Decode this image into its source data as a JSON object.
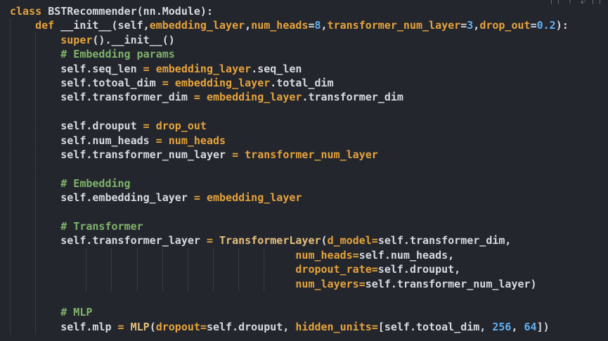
{
  "toolbar": {
    "icons": [
      "copy-icon",
      "split-icon",
      "branch-icon",
      "collapse-icon"
    ]
  },
  "code": {
    "lines": [
      [
        [
          "classkw",
          "class "
        ],
        [
          "plain",
          "BSTRecommender(nn.Module):"
        ]
      ],
      [
        [
          "plain",
          "    "
        ],
        [
          "def",
          "def "
        ],
        [
          "plain",
          "__init__(self,"
        ],
        [
          "param",
          "embedding_layer"
        ],
        [
          "plain",
          ","
        ],
        [
          "param",
          "num_heads"
        ],
        [
          "plain",
          "="
        ],
        [
          "num",
          "8"
        ],
        [
          "plain",
          ","
        ],
        [
          "param",
          "transformer_num_layer"
        ],
        [
          "plain",
          "="
        ],
        [
          "num",
          "3"
        ],
        [
          "plain",
          ","
        ],
        [
          "param",
          "drop_out"
        ],
        [
          "plain",
          "="
        ],
        [
          "num",
          "0.2"
        ],
        [
          "plain",
          "):"
        ]
      ],
      [
        [
          "plain",
          "        "
        ],
        [
          "builtin",
          "super"
        ],
        [
          "plain",
          "().__init__()"
        ]
      ],
      [
        [
          "plain",
          "        "
        ],
        [
          "cmt",
          "# Embedding params"
        ]
      ],
      [
        [
          "plain",
          "        self.seq_len "
        ],
        [
          "op",
          "="
        ],
        [
          "plain",
          " "
        ],
        [
          "param",
          "embedding_layer"
        ],
        [
          "plain",
          ".seq_len"
        ]
      ],
      [
        [
          "plain",
          "        self.totoal_dim "
        ],
        [
          "op",
          "="
        ],
        [
          "plain",
          " "
        ],
        [
          "param",
          "embedding_layer"
        ],
        [
          "plain",
          ".total_dim"
        ]
      ],
      [
        [
          "plain",
          "        self.transformer_dim "
        ],
        [
          "op",
          "="
        ],
        [
          "plain",
          " "
        ],
        [
          "param",
          "embedding_layer"
        ],
        [
          "plain",
          ".transformer_dim"
        ]
      ],
      [
        [
          "plain",
          ""
        ]
      ],
      [
        [
          "plain",
          "        self.drouput "
        ],
        [
          "op",
          "="
        ],
        [
          "plain",
          " "
        ],
        [
          "param",
          "drop_out"
        ]
      ],
      [
        [
          "plain",
          "        self.num_heads "
        ],
        [
          "op",
          "="
        ],
        [
          "plain",
          " "
        ],
        [
          "param",
          "num_heads"
        ]
      ],
      [
        [
          "plain",
          "        self.transformer_num_layer "
        ],
        [
          "op",
          "="
        ],
        [
          "plain",
          " "
        ],
        [
          "param",
          "transformer_num_layer"
        ]
      ],
      [
        [
          "plain",
          ""
        ]
      ],
      [
        [
          "plain",
          "        "
        ],
        [
          "cmt",
          "# Embedding"
        ]
      ],
      [
        [
          "plain",
          "        self.embedding_layer "
        ],
        [
          "op",
          "="
        ],
        [
          "plain",
          " "
        ],
        [
          "param",
          "embedding_layer"
        ]
      ],
      [
        [
          "plain",
          ""
        ]
      ],
      [
        [
          "plain",
          "        "
        ],
        [
          "cmt",
          "# Transformer"
        ]
      ],
      [
        [
          "plain",
          "        self.transformer_layer "
        ],
        [
          "op",
          "="
        ],
        [
          "plain",
          " "
        ],
        [
          "fn",
          "TransformerLayer"
        ],
        [
          "plain",
          "("
        ],
        [
          "param",
          "d_model"
        ],
        [
          "op",
          "="
        ],
        [
          "plain",
          "self.transformer_dim,"
        ]
      ],
      [
        [
          "plain",
          "                                             "
        ],
        [
          "param",
          "num_heads"
        ],
        [
          "op",
          "="
        ],
        [
          "plain",
          "self.num_heads,"
        ]
      ],
      [
        [
          "plain",
          "                                             "
        ],
        [
          "param",
          "dropout_rate"
        ],
        [
          "op",
          "="
        ],
        [
          "plain",
          "self.drouput,"
        ]
      ],
      [
        [
          "plain",
          "                                             "
        ],
        [
          "param",
          "num_layers"
        ],
        [
          "op",
          "="
        ],
        [
          "plain",
          "self.transformer_num_layer)"
        ]
      ],
      [
        [
          "plain",
          ""
        ]
      ],
      [
        [
          "plain",
          "        "
        ],
        [
          "cmt",
          "# MLP"
        ]
      ],
      [
        [
          "plain",
          "        self.mlp "
        ],
        [
          "op",
          "="
        ],
        [
          "plain",
          " "
        ],
        [
          "fn",
          "MLP"
        ],
        [
          "plain",
          "("
        ],
        [
          "param",
          "dropout"
        ],
        [
          "op",
          "="
        ],
        [
          "plain",
          "self.drouput, "
        ],
        [
          "param",
          "hidden_units"
        ],
        [
          "op",
          "="
        ],
        [
          "plain",
          "[self.totoal_dim, "
        ],
        [
          "num",
          "256"
        ],
        [
          "plain",
          ", "
        ],
        [
          "num",
          "64"
        ],
        [
          "plain",
          "])"
        ]
      ]
    ]
  },
  "colors": {
    "background": "#24262e",
    "keyword": "#e5a33b",
    "comment": "#7fb36a",
    "number": "#61afef",
    "text": "#d7dae0"
  }
}
